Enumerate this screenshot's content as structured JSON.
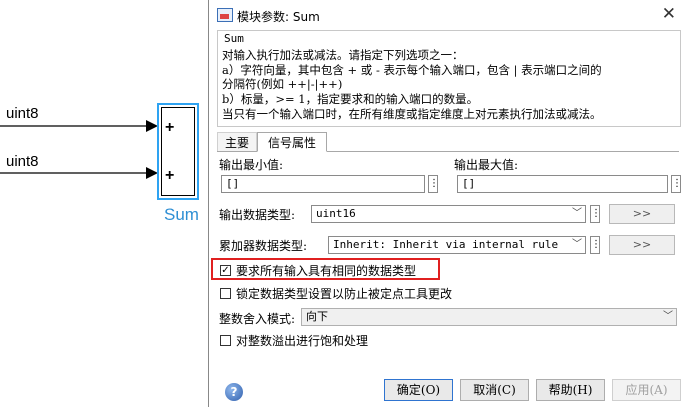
{
  "canvas": {
    "inputs": [
      "uint8",
      "uint8"
    ],
    "port_signs": [
      "+",
      "+"
    ],
    "block_name": "Sum"
  },
  "dialog": {
    "title": "模块参数: Sum",
    "description": {
      "heading": "Sum",
      "lines": [
        "对输入执行加法或减法。请指定下列选项之一：",
        "a）字符向量，其中包含 + 或 - 表示每个输入端口，包含 | 表示端口之间的",
        "分隔符(例如 ++|-|++)",
        "b）标量，>= 1，指定要求和的输入端口的数量。",
        "  当只有一个输入端口时，在所有维度或指定维度上对元素执行加法或减法。"
      ]
    },
    "tabs": [
      {
        "label": "主要",
        "active": false
      },
      {
        "label": "信号属性",
        "active": true
      }
    ],
    "signal_attributes": {
      "output_min_label": "输出最小值:",
      "output_min_value": "[]",
      "output_max_label": "输出最大值:",
      "output_max_value": "[]",
      "output_type_label": "输出数据类型:",
      "output_type_value": "uint16",
      "accum_type_label": "累加器数据类型:",
      "accum_type_value": "Inherit: Inherit via internal rule",
      "assistant_button": ">>",
      "require_same_type_label": "要求所有输入具有相同的数据类型",
      "require_same_type_checked": true,
      "lock_type_label": "锁定数据类型设置以防止被定点工具更改",
      "lock_type_checked": false,
      "rounding_label": "整数舍入模式:",
      "rounding_value": "向下",
      "saturate_label": "对整数溢出进行饱和处理",
      "saturate_checked": false
    },
    "buttons": {
      "ok": "确定(O)",
      "cancel": "取消(C)",
      "help": "帮助(H)",
      "apply": "应用(A)"
    }
  },
  "colors": {
    "block_border": "#2ea3f2",
    "block_name": "#2e8fd4",
    "highlight": "#e02020"
  }
}
